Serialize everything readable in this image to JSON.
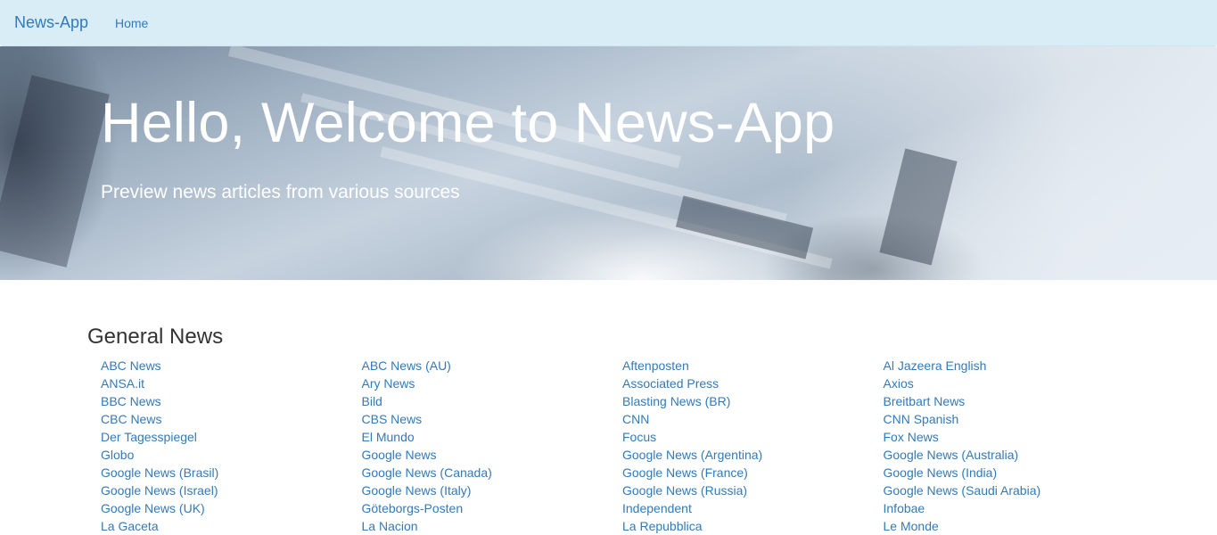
{
  "navbar": {
    "brand": "News-App",
    "home": "Home"
  },
  "hero": {
    "title": "Hello, Welcome to News-App",
    "subtitle": "Preview news articles from various sources"
  },
  "general": {
    "title": "General News",
    "sources": [
      "ABC News",
      "ABC News (AU)",
      "Aftenposten",
      "Al Jazeera English",
      "ANSA.it",
      "Ary News",
      "Associated Press",
      "Axios",
      "BBC News",
      "Bild",
      "Blasting News (BR)",
      "Breitbart News",
      "CBC News",
      "CBS News",
      "CNN",
      "CNN Spanish",
      "Der Tagesspiegel",
      "El Mundo",
      "Focus",
      "Fox News",
      "Globo",
      "Google News",
      "Google News (Argentina)",
      "Google News (Australia)",
      "Google News (Brasil)",
      "Google News (Canada)",
      "Google News (France)",
      "Google News (India)",
      "Google News (Israel)",
      "Google News (Italy)",
      "Google News (Russia)",
      "Google News (Saudi Arabia)",
      "Google News (UK)",
      "Göteborgs-Posten",
      "Independent",
      "Infobae",
      "La Gaceta",
      "La Nacion",
      "La Repubblica",
      "Le Monde"
    ]
  },
  "colors": {
    "navbar_bg": "#d9edf7",
    "link": "#337ab7",
    "text": "#333333"
  }
}
